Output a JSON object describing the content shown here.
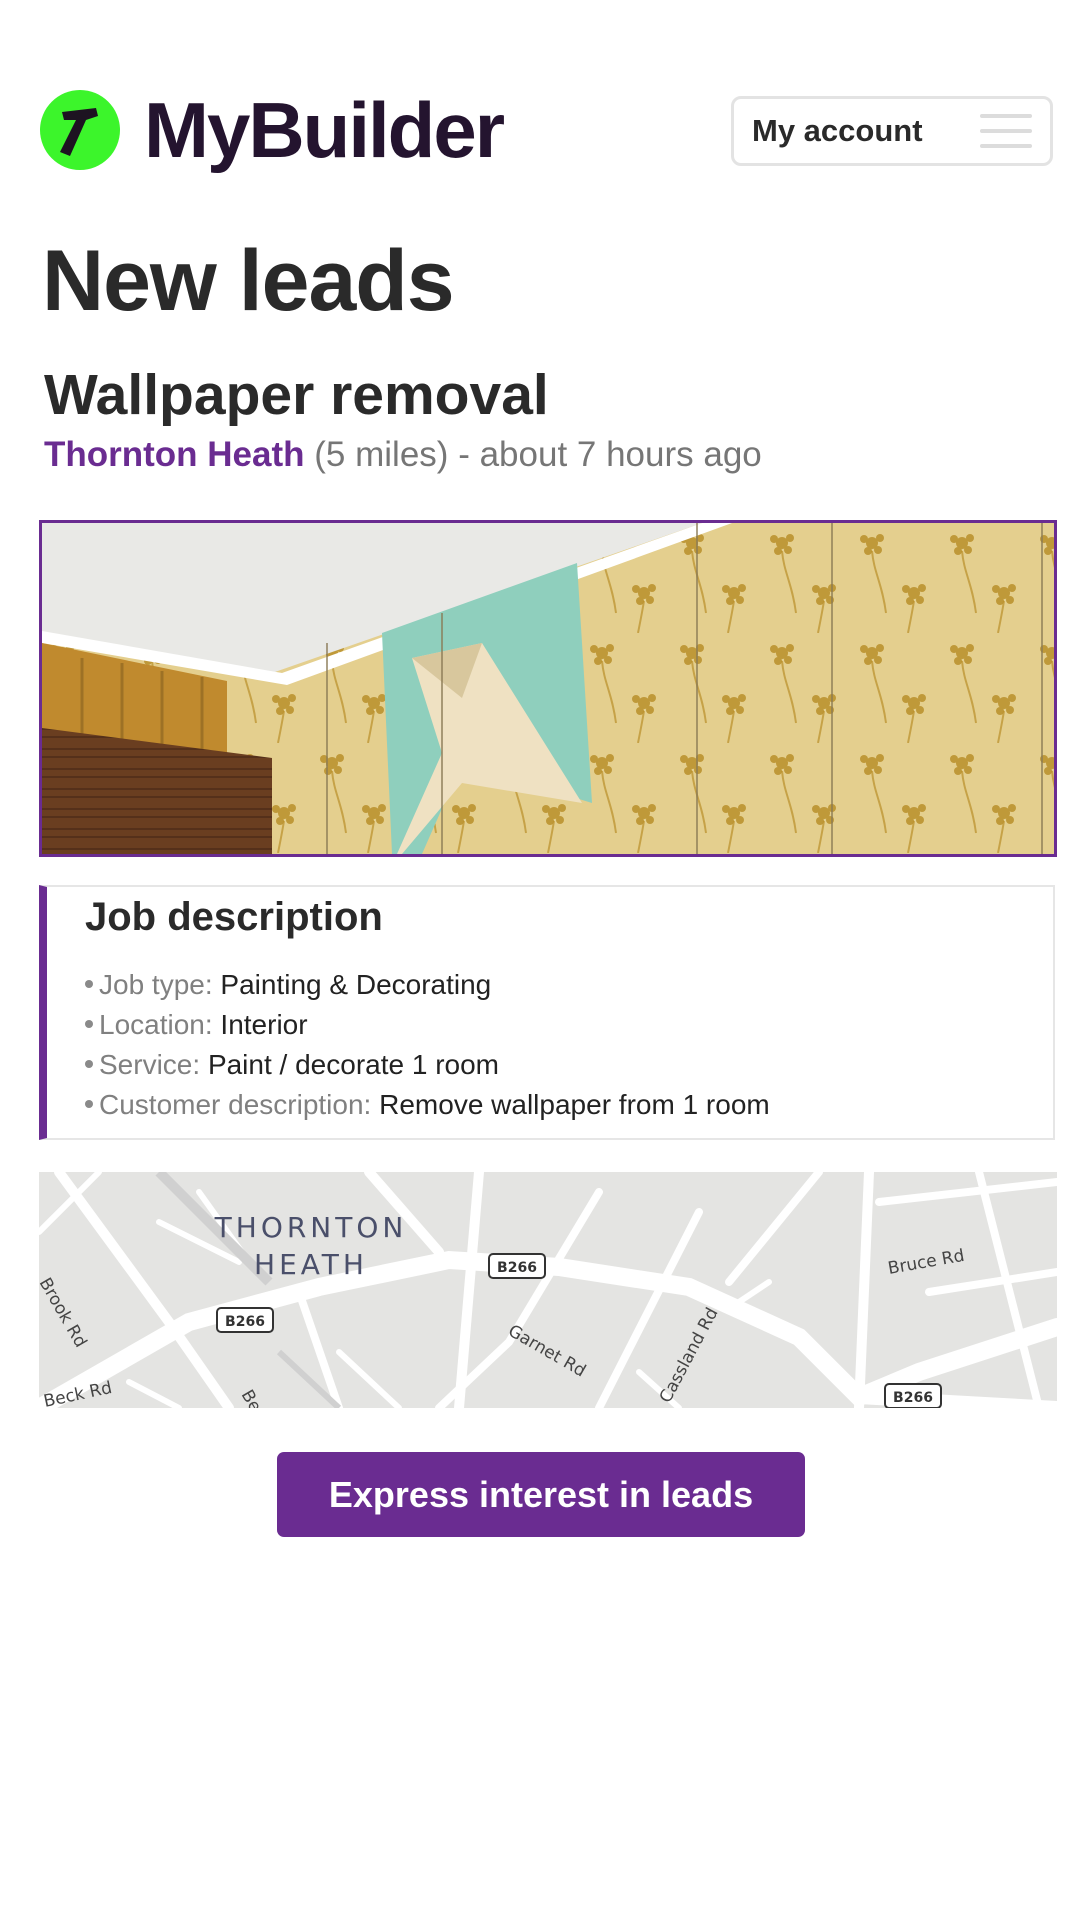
{
  "brand": {
    "name": "MyBuilder",
    "badge_color": "#3cf52b",
    "icon": "hammer-icon"
  },
  "header": {
    "account_label": "My account",
    "menu_icon": "hamburger-menu-icon"
  },
  "page_title": "New leads",
  "lead": {
    "title": "Wallpaper removal",
    "location": "Thornton Heath",
    "distance": "(5 miles)",
    "separator": "-",
    "posted": "about 7 hours ago",
    "photo_description": "Peeling floral wallpaper on a wall below the ceiling",
    "description": {
      "heading": "Job description",
      "items": [
        {
          "key": "Job type:",
          "value": "Painting & Decorating"
        },
        {
          "key": "Location:",
          "value": "Interior"
        },
        {
          "key": "Service:",
          "value": "Paint / decorate 1 room"
        },
        {
          "key": "Customer description:",
          "value": "Remove wallpaper from 1 room"
        }
      ]
    },
    "map": {
      "area_label_1": "THORNTON",
      "area_label_2": "HEATH",
      "road_b266": "B266",
      "streets": [
        "Bruce Rd",
        "Garnet Rd",
        "Cassland Rd",
        "Brook Rd",
        "Beck Rd",
        "Ben"
      ]
    }
  },
  "cta": {
    "label": "Express interest in leads"
  },
  "colors": {
    "accent": "#6a2c91",
    "text": "#2a2a2a",
    "muted": "#767676"
  }
}
